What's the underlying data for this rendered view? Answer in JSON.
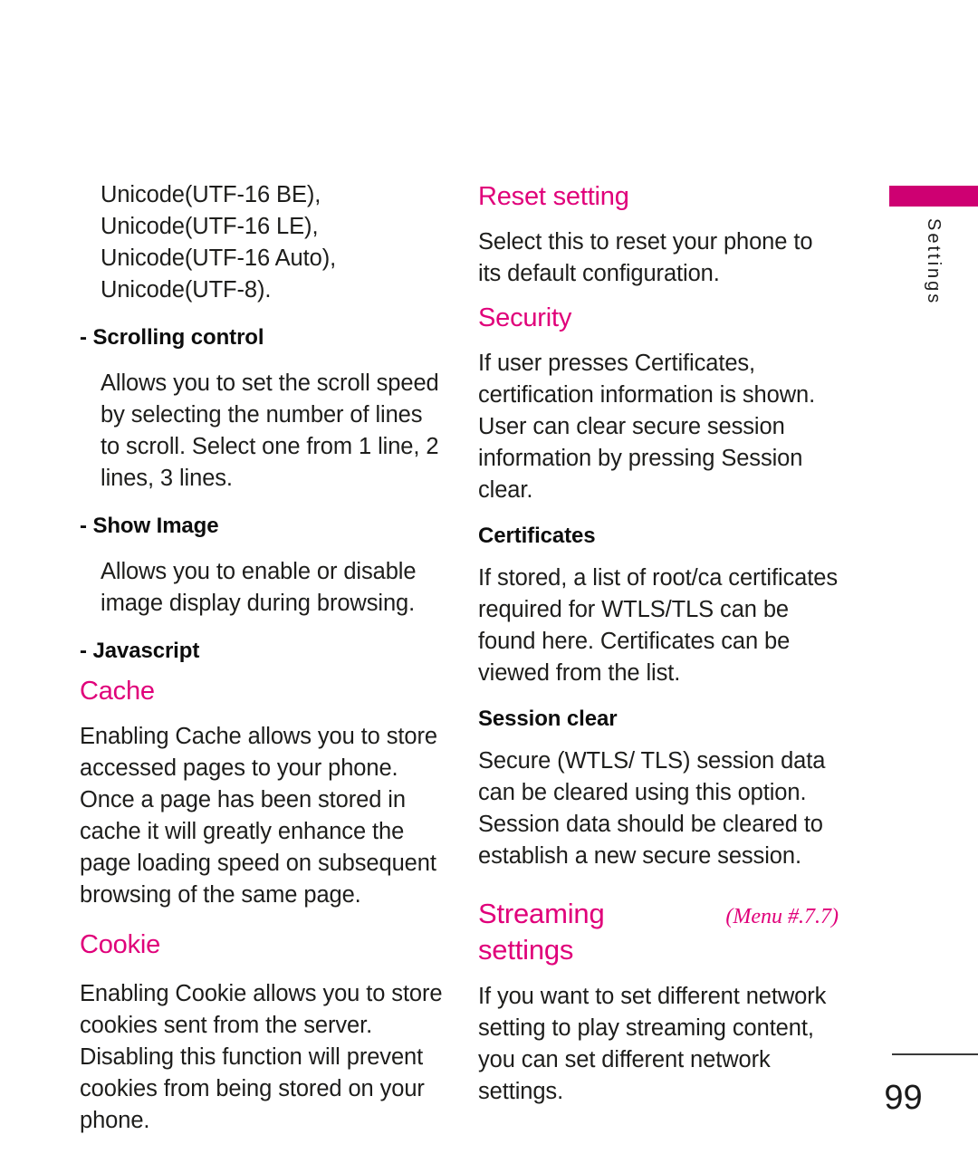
{
  "page": {
    "number": "99",
    "side_tab_label": "Settings",
    "accent_color": "#E0007A",
    "tab_bar_color": "#CE0072"
  },
  "left_column": {
    "blocks": [
      {
        "kind": "para-indent",
        "text": "Unicode(UTF-16 BE), Unicode(UTF-16 LE), Unicode(UTF-16 Auto), Unicode(UTF-8)."
      },
      {
        "kind": "sub-head",
        "text": "- Scrolling control"
      },
      {
        "kind": "para-indent",
        "text": "Allows you to set the scroll speed by selecting the number of lines to scroll.  Select one from 1 line, 2 lines, 3 lines."
      },
      {
        "kind": "sub-head",
        "text": "- Show Image"
      },
      {
        "kind": "para-indent",
        "text": "Allows you to enable or disable image display during browsing."
      },
      {
        "kind": "sub-head",
        "text": "- Javascript"
      },
      {
        "kind": "pink-head",
        "text": "Cache"
      },
      {
        "kind": "para",
        "text": "Enabling Cache allows you to store accessed pages to your phone. Once a page has been stored in cache it will greatly enhance the page loading speed on subsequent browsing of the same page."
      },
      {
        "kind": "pink-head",
        "text": "Cookie"
      },
      {
        "kind": "para",
        "text": "Enabling Cookie allows you to store cookies sent from the server. Disabling this function will prevent cookies from being stored on your phone."
      }
    ]
  },
  "right_column": {
    "blocks": [
      {
        "kind": "pink-head",
        "text": "Reset setting"
      },
      {
        "kind": "para",
        "text": "Select this to reset your phone to its default configuration."
      },
      {
        "kind": "pink-head",
        "text": "Security"
      },
      {
        "kind": "para",
        "text": "If user presses Certificates, certification information is shown."
      },
      {
        "kind": "para",
        "text": "User can clear secure session information by pressing Session clear."
      },
      {
        "kind": "sub-head",
        "text": "Certificates"
      },
      {
        "kind": "para",
        "text": "If stored, a list of root/ca certificates required for WTLS/TLS can be found here. Certificates can be viewed from the list."
      },
      {
        "kind": "sub-head",
        "text": "Session clear"
      },
      {
        "kind": "para",
        "text": "Secure (WTLS/ TLS) session data can be cleared using this option. Session data should be cleared to establish a new secure session."
      }
    ],
    "section": {
      "title": "Streaming settings",
      "menu_ref": "(Menu #.7.7)",
      "body": "If you want to set different network setting to play streaming content, you can set different network settings."
    }
  }
}
